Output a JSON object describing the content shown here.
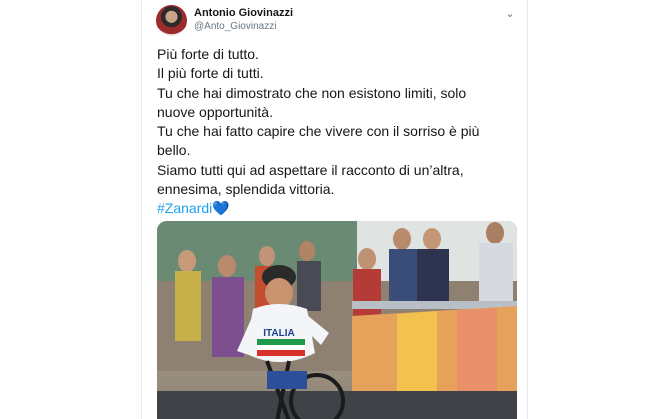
{
  "tweet": {
    "author": {
      "display_name": "Antonio Giovinazzi",
      "handle": "@Anto_Giovinazzi"
    },
    "menu_icon": "chevron-down-icon",
    "text_lines": [
      "Più forte di tutto.",
      "Il più forte di tutti.",
      "Tu che hai dimostrato che non esistono limiti, solo",
      "nuove opportunità.",
      "Tu che hai fatto capire che vivere con il sorriso è più",
      "bello.",
      "Siamo tutti qui ad aspettare il racconto di un’altra,",
      "ennesima, splendida vittoria."
    ],
    "hashtag": "#Zanardi",
    "hashtag_emoji": "💙",
    "media": {
      "jersey_text": "ITALIA",
      "accent_colors": [
        "#1d3f8f",
        "#d8312a",
        "#1e9a4a"
      ]
    },
    "colors": {
      "link": "#1da1f2",
      "text": "#14171a",
      "secondary": "#657786"
    }
  }
}
